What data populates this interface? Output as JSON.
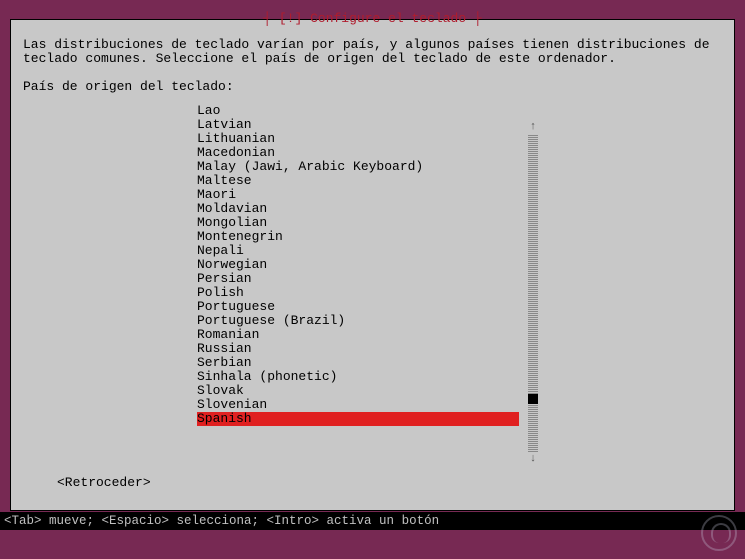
{
  "dialog": {
    "title": "┤ [!] Configure el teclado ├",
    "intro": "Las distribuciones de teclado varían por país, y algunos países tienen distribuciones de\nteclado comunes. Seleccione el país de origen del teclado de este ordenador.",
    "prompt": "País de origen del teclado:",
    "back_label": "<Retroceder>"
  },
  "list": {
    "items": [
      "Lao",
      "Latvian",
      "Lithuanian",
      "Macedonian",
      "Malay (Jawi, Arabic Keyboard)",
      "Maltese",
      "Maori",
      "Moldavian",
      "Mongolian",
      "Montenegrin",
      "Nepali",
      "Norwegian",
      "Persian",
      "Polish",
      "Portuguese",
      "Portuguese (Brazil)",
      "Romanian",
      "Russian",
      "Serbian",
      "Sinhala (phonetic)",
      "Slovak",
      "Slovenian",
      "Spanish"
    ],
    "selected_index": 22
  },
  "scroll": {
    "up_arrow": "↑",
    "down_arrow": "↓"
  },
  "helpbar": {
    "text": "<Tab> mueve; <Espacio> selecciona; <Intro> activa un botón"
  }
}
